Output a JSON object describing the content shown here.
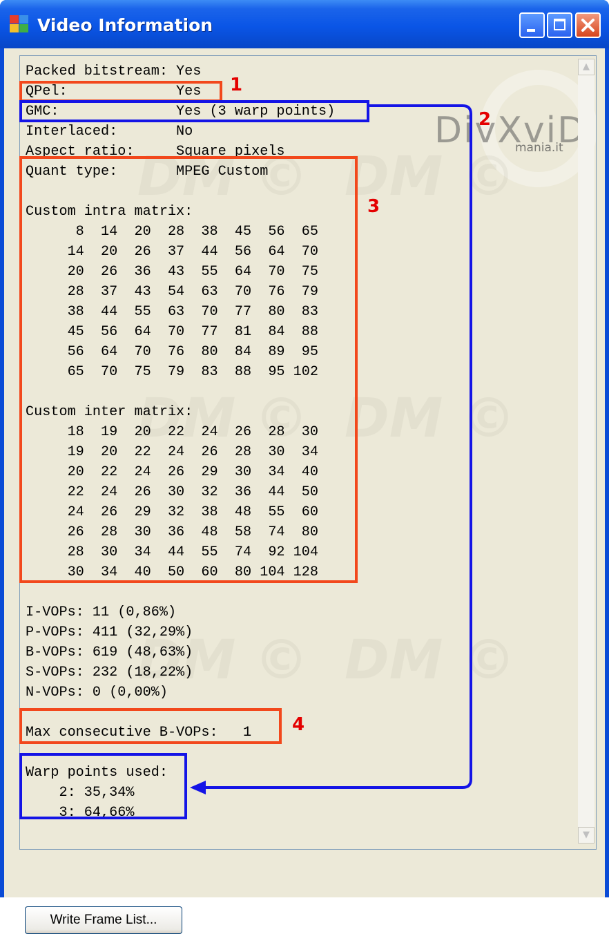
{
  "window": {
    "title": "Video Information"
  },
  "watermark": {
    "divx": "DivXviD",
    "site": "mania.it",
    "mark": "DM ©"
  },
  "info": {
    "lines": [
      "Packed bitstream: Yes",
      "QPel:             Yes",
      "GMC:              Yes (3 warp points)",
      "Interlaced:       No",
      "Aspect ratio:     Square pixels",
      "Quant type:       MPEG Custom",
      "",
      "Custom intra matrix:",
      "      8  14  20  28  38  45  56  65",
      "     14  20  26  37  44  56  64  70",
      "     20  26  36  43  55  64  70  75",
      "     28  37  43  54  63  70  76  79",
      "     38  44  55  63  70  77  80  83",
      "     45  56  64  70  77  81  84  88",
      "     56  64  70  76  80  84  89  95",
      "     65  70  75  79  83  88  95 102",
      "",
      "Custom inter matrix:",
      "     18  19  20  22  24  26  28  30",
      "     19  20  22  24  26  28  30  34",
      "     20  22  24  26  29  30  34  40",
      "     22  24  26  30  32  36  44  50",
      "     24  26  29  32  38  48  55  60",
      "     26  28  30  36  48  58  74  80",
      "     28  30  34  44  55  74  92 104",
      "     30  34  40  50  60  80 104 128",
      "",
      "I-VOPs: 11 (0,86%)",
      "P-VOPs: 411 (32,29%)",
      "B-VOPs: 619 (48,63%)",
      "S-VOPs: 232 (18,22%)",
      "N-VOPs: 0 (0,00%)",
      "",
      "Max consecutive B-VOPs:   1",
      "",
      "Warp points used:",
      "    2: 35,34%",
      "    3: 64,66%"
    ]
  },
  "annotations": {
    "labels": [
      "1",
      "2",
      "3",
      "4"
    ],
    "colors": {
      "red": "#f2481c",
      "blue": "#1414e6",
      "label": "#e40000"
    }
  },
  "buttons": {
    "write_frame_list": "Write Frame List..."
  }
}
